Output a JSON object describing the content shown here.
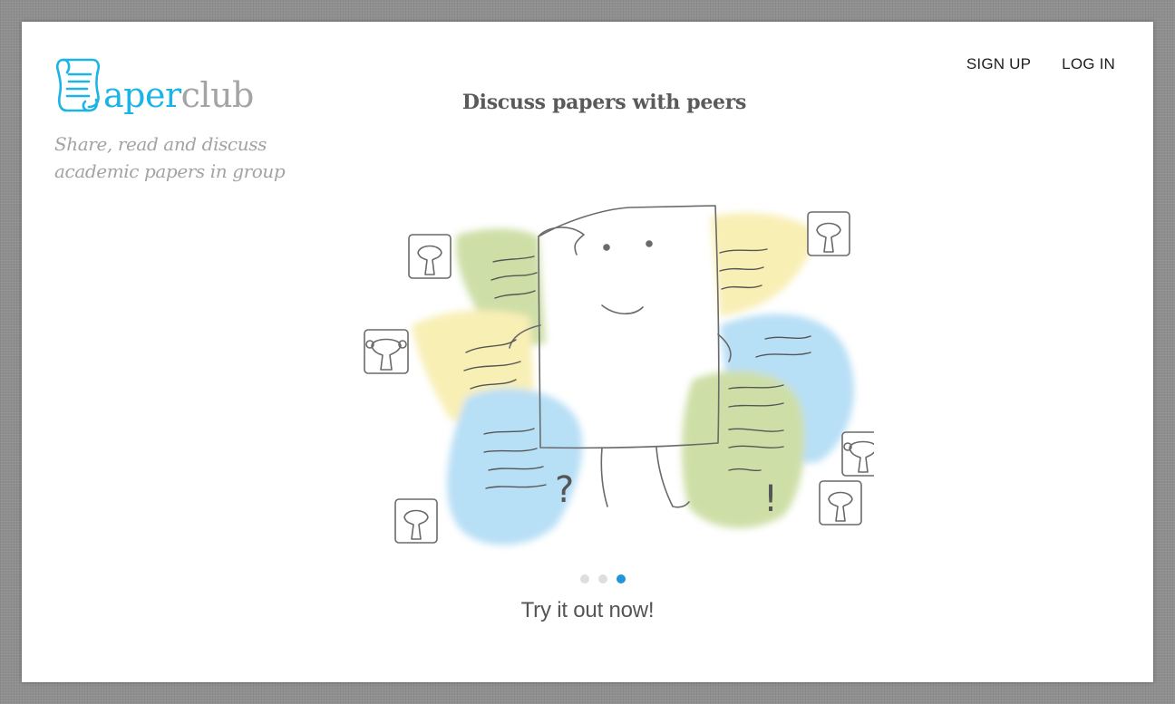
{
  "brand": {
    "logo_part1": "aper",
    "logo_part2": "club",
    "tagline": "Share, read and discuss academic papers in group",
    "primary_color": "#1ab4e6",
    "secondary_color": "#a4a4a4"
  },
  "nav": {
    "signup_label": "SIGN UP",
    "login_label": "LOG IN"
  },
  "hero": {
    "headline": "Discuss papers with peers",
    "illustration_icon": "paper-with-comments-illustration",
    "carousel": {
      "slide_count": 3,
      "active_index": 2,
      "active_color": "#1e96dc"
    }
  },
  "cta": {
    "label": "Try it out now!"
  }
}
